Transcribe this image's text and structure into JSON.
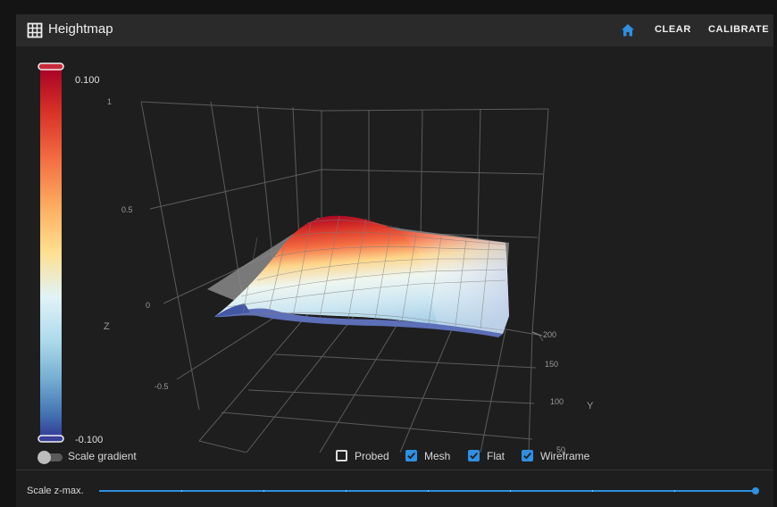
{
  "toolbar": {
    "title": "Heightmap",
    "title_icon": "grid-icon",
    "home_icon": "home-icon",
    "clear_label": "CLEAR",
    "calibrate_label": "CALIBRATE"
  },
  "colorbar": {
    "max_label": "0.100",
    "min_label": "-0.100",
    "gradient": [
      "#a50026",
      "#d73027",
      "#f46d43",
      "#fdae61",
      "#fee090",
      "#e0f3f8",
      "#abd9e9",
      "#74add1",
      "#4575b4",
      "#313695"
    ]
  },
  "chart_data": {
    "type": "surface3d",
    "z_axis": {
      "label": "Z",
      "ticks": [
        "1",
        "0.5",
        "0",
        "-0.5"
      ]
    },
    "y_axis": {
      "label": "Y",
      "ticks": [
        "200",
        "150",
        "100",
        "50"
      ]
    },
    "z_range": [
      -0.1,
      0.1
    ],
    "grid": true
  },
  "controls": {
    "scale_gradient_label": "Scale gradient",
    "scale_gradient_on": false,
    "checkboxes": [
      {
        "label": "Probed",
        "checked": false
      },
      {
        "label": "Mesh",
        "checked": true
      },
      {
        "label": "Flat",
        "checked": true
      },
      {
        "label": "Wireframe",
        "checked": true
      }
    ]
  },
  "slider": {
    "label": "Scale z-max.",
    "value_fraction": 1.0
  },
  "colors": {
    "accent": "#2f8fe0",
    "panel": "#1e1e1e",
    "toolbar": "#2a2a2a"
  }
}
